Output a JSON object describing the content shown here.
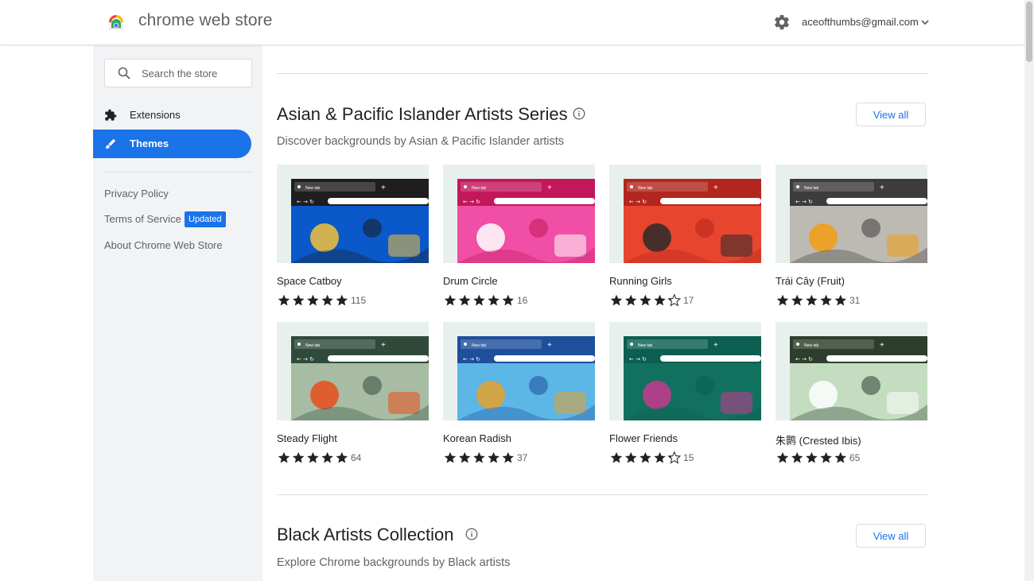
{
  "header": {
    "brand": "chrome web store",
    "account_email": "aceofthumbs@gmail.com"
  },
  "sidebar": {
    "search_placeholder": "Search the store",
    "items": [
      {
        "label": "Extensions",
        "icon": "puzzle-piece-icon",
        "active": false
      },
      {
        "label": "Themes",
        "icon": "paintbrush-icon",
        "active": true
      }
    ],
    "links": {
      "privacy": "Privacy Policy",
      "terms": "Terms of Service",
      "terms_badge": "Updated",
      "about": "About Chrome Web Store"
    }
  },
  "sections": [
    {
      "title": "Asian & Pacific Islander Artists Series",
      "subtitle": "Discover backgrounds by Asian & Pacific Islander artists",
      "view_all": "View all",
      "items": [
        {
          "name": "Space Catboy",
          "rating": 5,
          "count": "115",
          "frame": "#1e1e1e",
          "bg": "#0a58c9",
          "accent": "#f5c23b"
        },
        {
          "name": "Drum Circle",
          "rating": 5,
          "count": "16",
          "frame": "#c2185b",
          "bg": "#f04fa5",
          "accent": "#ffffff"
        },
        {
          "name": "Running Girls",
          "rating": 4.5,
          "count": "17",
          "frame": "#b3261e",
          "bg": "#e8452f",
          "accent": "#2a2a2a"
        },
        {
          "name": "Trái Cây (Fruit)",
          "rating": 5,
          "count": "31",
          "frame": "#3c3c3c",
          "bg": "#bdbab3",
          "accent": "#f39c12"
        }
      ]
    },
    {
      "items": [
        {
          "name": "Steady Flight",
          "rating": 5,
          "count": "64",
          "frame": "#2f4a3b",
          "bg": "#a8bca4",
          "accent": "#e94e1b"
        },
        {
          "name": "Korean Radish",
          "rating": 5,
          "count": "37",
          "frame": "#1d4f9c",
          "bg": "#5cb6e6",
          "accent": "#e6a12b"
        },
        {
          "name": "Flower Friends",
          "rating": 4.5,
          "count": "15",
          "frame": "#0b5e50",
          "bg": "#12705f",
          "accent": "#c9388e"
        },
        {
          "name": "朱鹮 (Crested Ibis)",
          "rating": 5,
          "count": "65",
          "frame": "#2d3e2d",
          "bg": "#c4dcc0",
          "accent": "#ffffff"
        }
      ]
    },
    {
      "title": "Black Artists Collection",
      "subtitle": "Explore Chrome backgrounds by Black artists",
      "view_all": "View all"
    }
  ],
  "thumbnail_browser": {
    "tab_label": "New tab",
    "plus": "+"
  },
  "colors": {
    "accent_blue": "#1a73e8",
    "sidebar_bg": "#f1f3f4",
    "star": "#202124"
  }
}
